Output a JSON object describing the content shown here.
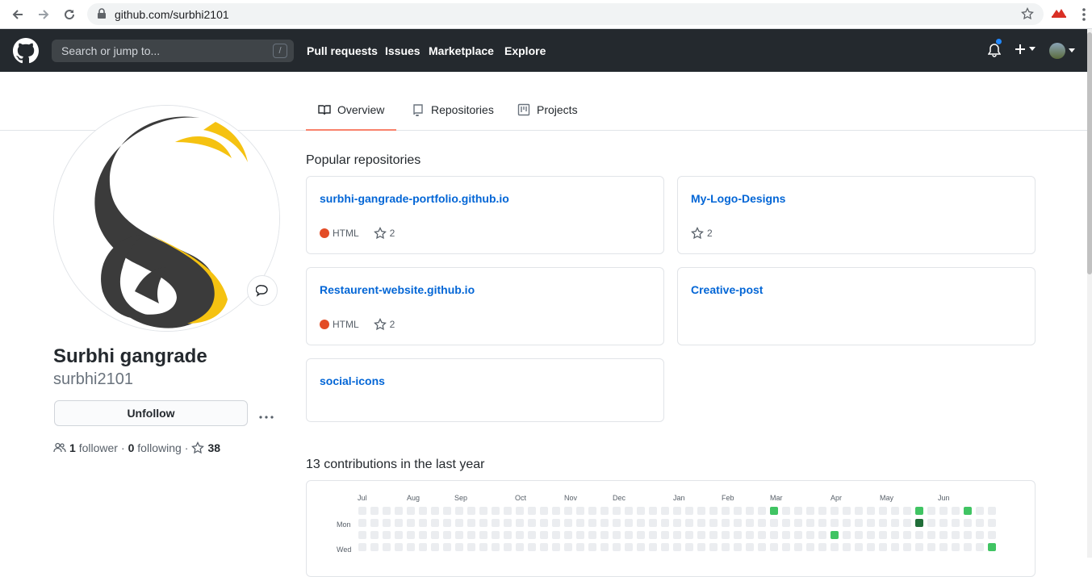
{
  "browser": {
    "url": "github.com/surbhi2101"
  },
  "header": {
    "search_placeholder": "Search or jump to...",
    "search_key": "/",
    "links": [
      "Pull requests",
      "Issues",
      "Marketplace",
      "Explore"
    ]
  },
  "tabs": [
    {
      "label": "Overview",
      "active": true
    },
    {
      "label": "Repositories",
      "active": false
    },
    {
      "label": "Projects",
      "active": false
    }
  ],
  "profile": {
    "name": "Surbhi gangrade",
    "login": "surbhi2101",
    "unfollow_label": "Unfollow",
    "followers_count": "1",
    "followers_label": "follower",
    "following_count": "0",
    "following_label": "following",
    "stars_count": "38",
    "sep": "·"
  },
  "popular": {
    "title": "Popular repositories",
    "repos": [
      {
        "name": "surbhi-gangrade-portfolio.github.io",
        "lang": "HTML",
        "stars": "2"
      },
      {
        "name": "My-Logo-Designs",
        "lang": "",
        "stars": "2"
      },
      {
        "name": "Restaurent-website.github.io",
        "lang": "HTML",
        "stars": "2"
      },
      {
        "name": "Creative-post",
        "lang": "",
        "stars": ""
      },
      {
        "name": "social-icons",
        "lang": "",
        "stars": ""
      }
    ]
  },
  "contributions": {
    "title": "13 contributions in the last year",
    "months": [
      "Jul",
      "Aug",
      "Sep",
      "Oct",
      "Nov",
      "Dec",
      "Jan",
      "Feb",
      "Mar",
      "Apr",
      "May",
      "Jun"
    ],
    "days": [
      "Mon",
      "Wed"
    ],
    "colors": {
      "empty": "#ebedf0",
      "l1": "#40c463",
      "l3": "#216e39"
    }
  },
  "colors": {
    "header_bg": "#24292e",
    "link": "#0366d6",
    "tab_underline": "#f9826c",
    "html_lang": "#e34c26"
  }
}
